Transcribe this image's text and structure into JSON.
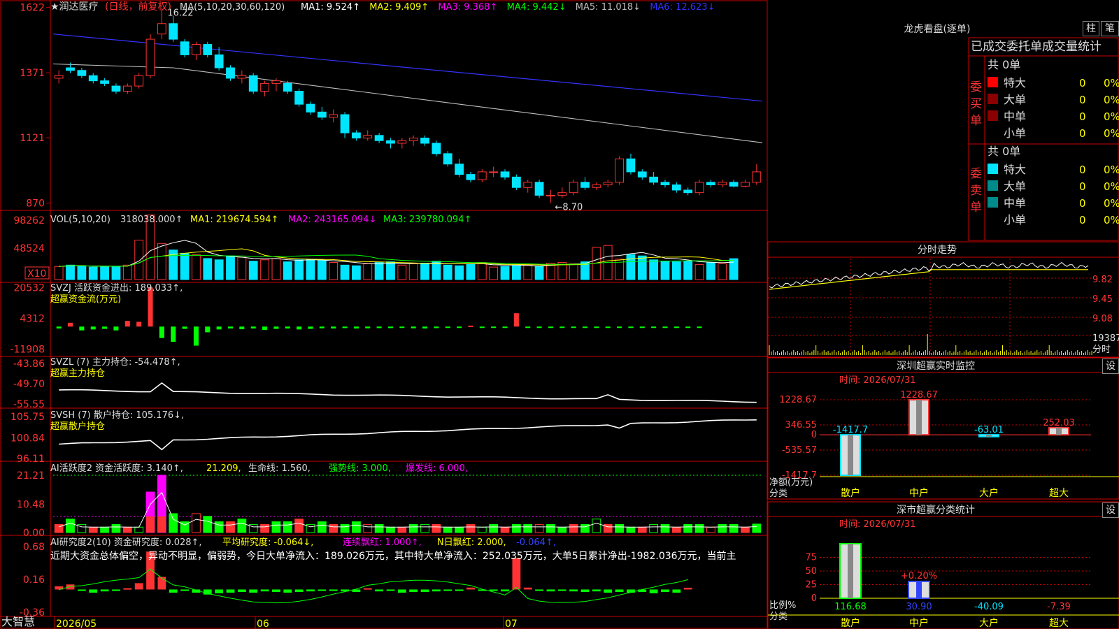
{
  "app": {
    "brand": "大智慧"
  },
  "main_title": {
    "star": "★",
    "name": "润达医疗",
    "mode": "(日线，前复权)"
  },
  "ma_legend": {
    "label": "MA(5,10,20,30,60,120)",
    "items": [
      {
        "text": "MA1: 9.524↑",
        "color": "#ffffff"
      },
      {
        "text": "MA2: 9.409↑",
        "color": "#ffff00"
      },
      {
        "text": "MA3: 9.368↑",
        "color": "#ff00ff"
      },
      {
        "text": "MA4: 9.442↓",
        "color": "#00ff00"
      },
      {
        "text": "MA5: 11.018↓",
        "color": "#c0c0c0"
      },
      {
        "text": "MA6: 12.623↓",
        "color": "#3333ff"
      }
    ]
  },
  "price_axis": {
    "ticks": [
      "1622",
      "1371",
      "1121",
      "870"
    ],
    "high_label": "16.22",
    "low_label": "←8.70"
  },
  "vol_panel": {
    "label": "VOL(5,10,20)",
    "value": "318038.000↑",
    "ma1": "MA1: 219674.594↑",
    "ma2": "MA2: 243165.094↓",
    "ma3": "MA3: 239780.094↑",
    "ticks": [
      "98262",
      "48524"
    ],
    "unit": "X10"
  },
  "svzj_panel": {
    "label": "SVZJ  活跃资金进出: 189.033↑,",
    "sub": "超赢资金流(万元)",
    "ticks": [
      "20532",
      "4312",
      "-11908"
    ]
  },
  "svzl_panel": {
    "label": "SVZL (7) 主力持仓: -54.478↑,",
    "sub": "超赢主力持仓",
    "ticks": [
      "-43.86",
      "-49.70",
      "-55.55"
    ]
  },
  "svsh_panel": {
    "label": "SVSH (7) 散户持仓: 105.176↓,",
    "sub": "超赢散户持仓",
    "ticks": [
      "105.75",
      "100.84",
      "96.11"
    ]
  },
  "ai_active_panel": {
    "label": "AI活跃度2 资金活跃度: 3.140↑,",
    "v2": "21.209,",
    "v3": "生命线: 1.560,",
    "v4": "强势线: 3.000,",
    "v5": "爆发线: 6.000,",
    "ticks": [
      "21.21",
      "10.48",
      "0.00"
    ]
  },
  "ai_research_panel": {
    "label": "AI研究度2(10) 资金研究度: 0.028↑,",
    "v2": "平均研究度: -0.064↓,",
    "v3": "连续飘红: 1.000↑,",
    "v4": "N日飘红: 2.000,",
    "v5": "-0.064↑,",
    "commentary": "近期大资金总体偏空，异动不明显，偏弱势，今日大单净流入：189.026万元，其中特大单净流入：252.035万元，大单5日累计净出-1982.036万元，当前主",
    "ticks": [
      "0.68",
      "0.16",
      "-0.36"
    ]
  },
  "date_axis": {
    "labels": [
      "2026/05",
      "06",
      "07"
    ]
  },
  "dragon_tiger": {
    "title": "龙虎看盘(逐单)",
    "btn1": "柱",
    "btn2": "笔",
    "tab_label": "已成交委托单成交量统计",
    "buy_side": "委买单",
    "sell_side": "委卖单",
    "buy_total": "共 0单",
    "sell_total": "共 0单",
    "rows": [
      {
        "name": "特大",
        "count": "0",
        "pct": "0%"
      },
      {
        "name": "大单",
        "count": "0",
        "pct": "0%"
      },
      {
        "name": "中单",
        "count": "0",
        "pct": "0%"
      },
      {
        "name": "小单",
        "count": "0",
        "pct": "0%"
      }
    ]
  },
  "intraday": {
    "title": "分时走势",
    "ticks": [
      "9.82",
      "9.45",
      "9.08"
    ],
    "vol_tick": "19387",
    "vol_unit": "分时"
  },
  "sz_monitor": {
    "title": "深圳超赢实时监控",
    "btn": "设",
    "time": "时间: 2026/07/31",
    "ticks": [
      "1228.67",
      "346.55",
      "0",
      "-535.57",
      "-1417.7"
    ],
    "axis_label1": "净额(万元)",
    "axis_label2": "分类",
    "categories": [
      "散户",
      "中户",
      "大户",
      "超大"
    ],
    "values": [
      -1417.7,
      1228.67,
      -63.01,
      252.03
    ],
    "value_labels": [
      "-1417.7",
      "1228.67",
      "-63.01",
      "252.03"
    ],
    "bar_colors": [
      "#00e5ff",
      "#ff3333",
      "#00e5ff",
      "#ff3333"
    ]
  },
  "sz_classify": {
    "title": "深市超赢分类统计",
    "btn": "设",
    "time": "时间: 2026/07/31",
    "ticks": [
      "75",
      "50",
      "25",
      "0"
    ],
    "axis_label1": "比例%",
    "axis_label2": "分类",
    "categories": [
      "散户",
      "中户",
      "大户",
      "超大"
    ],
    "values": [
      116.68,
      30.9,
      -40.09,
      -7.39
    ],
    "value_labels": [
      "116.68",
      "30.90",
      "-40.09",
      "-7.39"
    ],
    "mid_label": "+0.20%",
    "label_colors": [
      "#00ff00",
      "#3344ff",
      "#00e5ff",
      "#ff3333"
    ]
  },
  "chart_data": {
    "type": "candlestick",
    "dates": [
      "2026/05",
      "06",
      "07"
    ],
    "ohlc": [
      [
        13.5,
        13.8,
        13.3,
        13.6
      ],
      [
        13.9,
        14.1,
        13.7,
        13.8
      ],
      [
        13.8,
        13.9,
        13.5,
        13.6
      ],
      [
        13.6,
        13.7,
        13.3,
        13.4
      ],
      [
        13.4,
        13.5,
        13.2,
        13.3
      ],
      [
        13.2,
        13.3,
        12.9,
        13.0
      ],
      [
        13.0,
        13.3,
        12.9,
        13.2
      ],
      [
        13.2,
        13.7,
        13.1,
        13.6
      ],
      [
        13.6,
        15.2,
        13.5,
        15.0
      ],
      [
        15.2,
        16.22,
        15.0,
        15.6
      ],
      [
        15.6,
        15.9,
        14.9,
        15.0
      ],
      [
        14.9,
        15.0,
        14.3,
        14.4
      ],
      [
        14.4,
        14.9,
        14.2,
        14.8
      ],
      [
        14.8,
        14.9,
        14.3,
        14.4
      ],
      [
        14.4,
        14.7,
        13.8,
        13.9
      ],
      [
        13.9,
        14.0,
        13.4,
        13.5
      ],
      [
        13.5,
        13.8,
        13.3,
        13.6
      ],
      [
        13.6,
        13.7,
        12.9,
        13.0
      ],
      [
        13.0,
        13.4,
        12.8,
        13.3
      ],
      [
        13.3,
        13.5,
        13.0,
        13.4
      ],
      [
        13.3,
        13.4,
        12.9,
        13.0
      ],
      [
        13.0,
        13.1,
        12.4,
        12.5
      ],
      [
        12.5,
        12.6,
        12.1,
        12.2
      ],
      [
        12.2,
        12.4,
        11.9,
        12.0
      ],
      [
        12.0,
        12.3,
        11.8,
        12.1
      ],
      [
        12.1,
        12.2,
        11.2,
        11.4
      ],
      [
        11.4,
        11.5,
        11.1,
        11.2
      ],
      [
        11.2,
        11.5,
        11.1,
        11.3
      ],
      [
        11.3,
        11.4,
        11.0,
        11.1
      ],
      [
        11.1,
        11.2,
        10.8,
        11.0
      ],
      [
        11.0,
        11.2,
        10.8,
        11.1
      ],
      [
        11.1,
        11.3,
        10.9,
        11.2
      ],
      [
        11.2,
        11.3,
        10.9,
        11.0
      ],
      [
        11.0,
        11.1,
        10.5,
        10.6
      ],
      [
        10.6,
        10.7,
        10.1,
        10.2
      ],
      [
        10.2,
        10.4,
        9.7,
        9.8
      ],
      [
        9.8,
        9.9,
        9.5,
        9.6
      ],
      [
        9.6,
        10.0,
        9.5,
        9.9
      ],
      [
        9.9,
        10.1,
        9.7,
        9.9
      ],
      [
        9.9,
        10.0,
        9.6,
        9.7
      ],
      [
        9.7,
        9.8,
        9.2,
        9.3
      ],
      [
        9.3,
        9.6,
        9.1,
        9.5
      ],
      [
        9.5,
        9.6,
        8.9,
        9.0
      ],
      [
        9.0,
        9.2,
        8.7,
        9.0
      ],
      [
        9.0,
        9.3,
        8.9,
        9.1
      ],
      [
        9.1,
        9.6,
        9.0,
        9.5
      ],
      [
        9.5,
        9.7,
        9.2,
        9.3
      ],
      [
        9.3,
        9.5,
        9.2,
        9.4
      ],
      [
        9.4,
        9.6,
        9.3,
        9.5
      ],
      [
        9.5,
        10.5,
        9.4,
        10.4
      ],
      [
        10.4,
        10.6,
        9.8,
        9.9
      ],
      [
        9.9,
        10.0,
        9.6,
        9.7
      ],
      [
        9.7,
        9.9,
        9.4,
        9.5
      ],
      [
        9.5,
        9.6,
        9.3,
        9.4
      ],
      [
        9.4,
        9.5,
        9.1,
        9.2
      ],
      [
        9.2,
        9.3,
        9.0,
        9.1
      ],
      [
        9.1,
        9.6,
        9.0,
        9.5
      ],
      [
        9.5,
        9.6,
        9.3,
        9.4
      ],
      [
        9.4,
        9.6,
        9.3,
        9.5
      ],
      [
        9.5,
        9.6,
        9.3,
        9.35
      ],
      [
        9.35,
        9.6,
        9.3,
        9.5
      ],
      [
        9.5,
        10.2,
        9.4,
        9.9
      ]
    ],
    "volume": [
      20000,
      22000,
      21000,
      19000,
      19500,
      20000,
      22000,
      60000,
      98262,
      55000,
      45000,
      40000,
      38000,
      32000,
      30000,
      36000,
      34000,
      28000,
      30000,
      32000,
      27000,
      30000,
      31000,
      29000,
      26000,
      22000,
      21000,
      24000,
      26000,
      27000,
      22000,
      24000,
      25000,
      28000,
      22000,
      21000,
      24000,
      26000,
      19000,
      20000,
      21000,
      22000,
      20000,
      25000,
      26000,
      24000,
      27000,
      49000,
      52000,
      31000,
      38000,
      36000,
      30000,
      28000,
      27000,
      28000,
      23000,
      26000,
      24000,
      31800
    ],
    "svzj": [
      -1000,
      2000,
      -2000,
      -1500,
      -1200,
      -2000,
      3000,
      2500,
      20532,
      -6000,
      -8000,
      -1200,
      -10000,
      -3000,
      -1500,
      -1000,
      -1400,
      -1000,
      -1800,
      -1200,
      -1000,
      -1500,
      -1200,
      -900,
      -1000,
      -800,
      -1000,
      -900,
      -800,
      -800,
      -700,
      -900,
      -1000,
      -800,
      -700,
      -600,
      500,
      -700,
      -500,
      -600,
      7000,
      -500,
      -600,
      -400,
      -700,
      -500,
      -700,
      -500,
      -600,
      -400,
      -500,
      -400,
      -500,
      -700,
      -400,
      -500,
      -300
    ],
    "active": [
      3,
      5,
      3,
      2,
      2,
      3,
      2,
      2,
      15,
      21.21,
      7,
      4,
      7,
      6,
      4,
      4,
      5,
      3,
      3,
      4,
      4,
      5,
      3,
      4,
      3,
      3,
      4,
      3,
      3,
      2,
      2,
      3,
      3,
      3,
      2,
      2,
      3,
      2,
      3,
      2,
      3,
      3,
      3,
      3,
      2,
      3,
      3,
      5,
      3,
      3,
      2,
      2,
      3,
      3,
      2,
      3,
      3,
      2,
      3,
      3,
      2,
      3.14
    ],
    "research": [
      0.05,
      0.08,
      -0.02,
      -0.05,
      -0.03,
      -0.01,
      0.02,
      0.1,
      0.6,
      0.2,
      -0.05,
      -0.02,
      -0.05,
      -0.08,
      -0.06,
      -0.05,
      -0.04,
      -0.05,
      -0.03,
      -0.04,
      -0.05,
      -0.04,
      -0.03,
      -0.02,
      -0.01,
      -0.03,
      -0.04,
      0.02,
      -0.03,
      -0.02,
      -0.05,
      -0.04,
      -0.04,
      -0.03,
      -0.02,
      -0.01,
      0.03,
      -0.02,
      -0.02,
      -0.03,
      0.5,
      0.03,
      -0.02,
      -0.03,
      -0.02,
      -0.03,
      -0.04,
      -0.03,
      -0.05,
      -0.04,
      -0.05,
      -0.04,
      -0.06,
      -0.04,
      -0.05,
      0.028
    ]
  }
}
